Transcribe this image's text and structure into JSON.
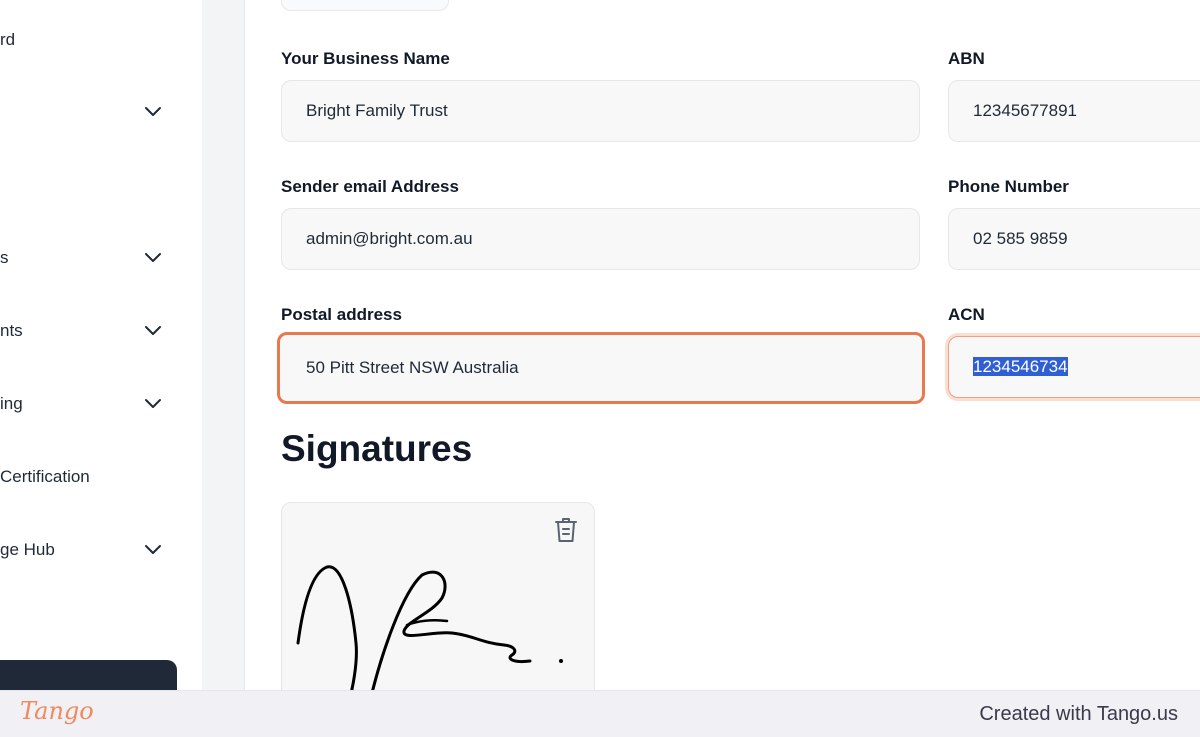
{
  "sidebar": {
    "items": [
      {
        "label": "rd",
        "has_chevron": false
      },
      {
        "label": "",
        "has_chevron": true
      },
      {
        "label": "s",
        "has_chevron": true
      },
      {
        "label": "nts",
        "has_chevron": true
      },
      {
        "label": "ing",
        "has_chevron": true
      },
      {
        "label": " Certification",
        "has_chevron": false
      },
      {
        "label": "ge Hub",
        "has_chevron": true
      }
    ]
  },
  "form": {
    "business_name": {
      "label": "Your Business Name",
      "value": "Bright Family Trust"
    },
    "abn": {
      "label": "ABN",
      "value": "12345677891"
    },
    "sender_email": {
      "label": "Sender email Address",
      "value": "admin@bright.com.au"
    },
    "phone": {
      "label": "Phone Number",
      "value": "02 585 9859"
    },
    "postal_address": {
      "label": "Postal address",
      "value": "50 Pitt  Street NSW Australia"
    },
    "acn": {
      "label": "ACN",
      "value": "1234546734",
      "selected": true
    }
  },
  "signatures": {
    "heading": "Signatures",
    "delete_icon": "trash-icon"
  },
  "footer": {
    "logo": "Tango",
    "credit": "Created with Tango.us"
  },
  "colors": {
    "focus_border": "#e8794f",
    "selection": "#2f5fd3",
    "sidebar_dark": "#1f2937",
    "logo": "#ef8a5c"
  }
}
